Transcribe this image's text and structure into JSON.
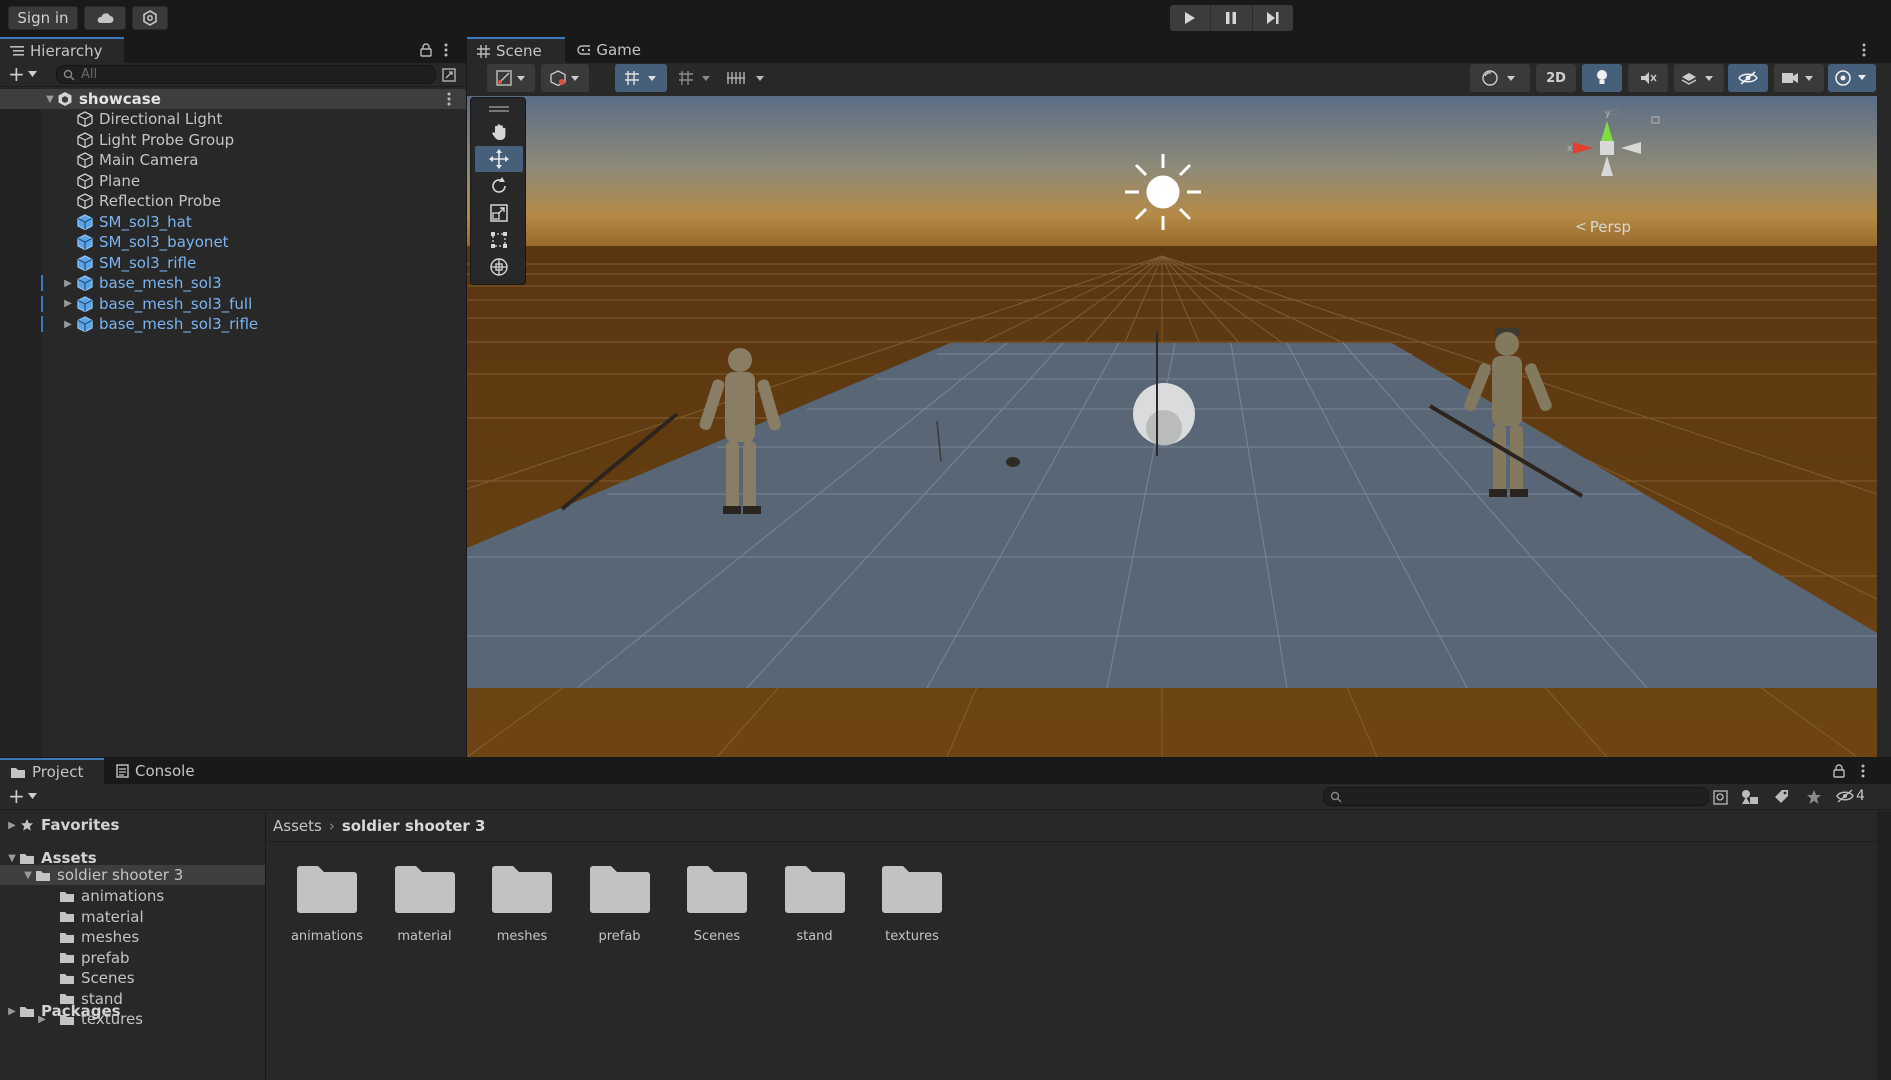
{
  "topbar": {
    "sign_in": "Sign in",
    "icons": [
      "cloud-icon",
      "collab-icon"
    ],
    "play": [
      "play-icon",
      "pause-icon",
      "step-icon"
    ]
  },
  "hierarchy": {
    "tab_label": "Hierarchy",
    "search_placeholder": "All",
    "scene_name": "showcase",
    "items": [
      {
        "label": "Directional Light",
        "prefab": false,
        "expandable": false
      },
      {
        "label": "Light Probe Group",
        "prefab": false,
        "expandable": false
      },
      {
        "label": "Main Camera",
        "prefab": false,
        "expandable": false
      },
      {
        "label": "Plane",
        "prefab": false,
        "expandable": false
      },
      {
        "label": "Reflection Probe",
        "prefab": false,
        "expandable": false
      },
      {
        "label": "SM_sol3_hat",
        "prefab": true,
        "expandable": false
      },
      {
        "label": "SM_sol3_bayonet",
        "prefab": true,
        "expandable": false
      },
      {
        "label": "SM_sol3_rifle",
        "prefab": true,
        "expandable": false
      },
      {
        "label": "base_mesh_sol3",
        "prefab": true,
        "expandable": true
      },
      {
        "label": "base_mesh_sol3_full",
        "prefab": true,
        "expandable": true
      },
      {
        "label": "base_mesh_sol3_rifle",
        "prefab": true,
        "expandable": true
      }
    ]
  },
  "scene": {
    "tabs": [
      "Scene",
      "Game"
    ],
    "mode_2d": "2D",
    "persp_label": "Persp",
    "gizmo_axes": {
      "y": "y",
      "x": "x"
    }
  },
  "bottom": {
    "tabs": [
      "Project",
      "Console"
    ],
    "hidden_count": "4",
    "breadcrumb": {
      "root": "Assets",
      "current": "soldier shooter 3"
    },
    "tree": {
      "favorites": "Favorites",
      "assets": "Assets",
      "project_folder": "soldier shooter 3",
      "subfolders": [
        "animations",
        "material",
        "meshes",
        "prefab",
        "Scenes",
        "stand",
        "textures"
      ],
      "packages": "Packages"
    },
    "grid_folders": [
      "animations",
      "material",
      "meshes",
      "prefab",
      "Scenes",
      "stand",
      "textures"
    ]
  },
  "colors": {
    "accent": "#3a79bb",
    "prefab_text": "#7cb3ee",
    "selected_tool": "#46607c"
  }
}
